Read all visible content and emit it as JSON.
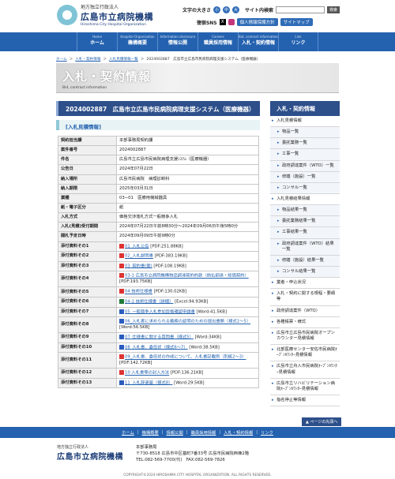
{
  "header": {
    "org_small": "地方独立行政法人",
    "org_name": "広島市立病院機構",
    "org_en": "Hiroshima City Hospital Organization",
    "font_size_label": "文字の大きさ",
    "font_btns": [
      "小",
      "中",
      "大"
    ],
    "search_label": "サイト内検索",
    "search_button": "検索",
    "sns_label": "徳宿SNS",
    "privacy_button": "個人情報保護方針",
    "sitemap_button": "サイトマップ"
  },
  "nav": [
    {
      "en": "Home",
      "jp": "ホーム"
    },
    {
      "en": "Hospital Organization",
      "jp": "機構概要"
    },
    {
      "en": "Information disclosure",
      "jp": "情報公開"
    },
    {
      "en": "Careers",
      "jp": "職員採用情報"
    },
    {
      "en": "Bid, contract information",
      "jp": "入札・契約情報"
    },
    {
      "en": "Link",
      "jp": "リンク"
    }
  ],
  "breadcrumb": [
    "ホーム",
    "入札・契約情報",
    "入札見積情報一覧",
    "2024002887　広島市立広島市民病院病理支援システム（医療機器）"
  ],
  "banner": {
    "title": "入札・契約情報",
    "subtitle": "Bid, contract information"
  },
  "page_title": "2024002887　広島市立広島市民病院病理支援システム（医療機器）",
  "section_title": "[入札見積情報]",
  "details": [
    {
      "k": "契約担当課",
      "v": "本部事務局契約課"
    },
    {
      "k": "案件番号",
      "v": "2024002887"
    },
    {
      "k": "件名",
      "v": "広島市立広島市民病院病理支援ｼｽﾃﾑ（医療機器）"
    },
    {
      "k": "公告日",
      "v": "2024年07月22日"
    },
    {
      "k": "納入場所",
      "v": "広島市民病院　病理診断科"
    },
    {
      "k": "納入期限",
      "v": "2025年03月31日"
    },
    {
      "k": "業種",
      "v": "03−01　医療用機械器具"
    },
    {
      "k": "紙・電子区分",
      "v": "紙"
    },
    {
      "k": "入札方式",
      "v": "価格交渉落札方式一般競争入札"
    },
    {
      "k": "入札(見積)受付期間",
      "v": "2024年07月22日午前8時30分〜2024年09月06日午後5時0分"
    },
    {
      "k": "開札予定日時",
      "v": "2024年09月09日午前9時0分"
    }
  ],
  "attachments": [
    {
      "k": "添付資料その1",
      "icon": "pdf",
      "link": "01_入札公告",
      "meta": "[PDF:251.88KB]"
    },
    {
      "k": "添付資料その2",
      "icon": "pdf",
      "link": "02_入札説明書",
      "meta": "[PDF:383.19KB]"
    },
    {
      "k": "添付資料その3",
      "icon": "pdf",
      "link": "03_契約書(案)",
      "meta": "[PDF:108.19KB]"
    },
    {
      "k": "添付資料その4",
      "icon": "pdf",
      "link": "03-1 広島市立病院機構物品調達契約約款（前払調達・総価契約）",
      "meta": "[PDF:193.75KB]"
    },
    {
      "k": "添付資料その5",
      "icon": "pdf",
      "link": "04 技術仕様書",
      "meta": "[PDF:130.02KB]"
    },
    {
      "k": "添付資料その6",
      "icon": "xls",
      "link": "04-1 技術仕様書（詳細）",
      "meta": "[Excel:94.93KB]"
    },
    {
      "k": "添付資料その7",
      "icon": "doc",
      "link": "05_一般競争入札参加資格確認申請書",
      "meta": "[Word:41.5KB]"
    },
    {
      "k": "添付資料その8",
      "icon": "doc",
      "link": "06_入札者に求められる義務の証明のための提出書類（様式1〜5）",
      "meta": "[Word:56.5KB]"
    },
    {
      "k": "添付資料その9",
      "icon": "doc",
      "link": "07_仕様書に関する質問書（様式5）",
      "meta": "[Word:34KB]"
    },
    {
      "k": "添付資料その10",
      "icon": "doc",
      "link": "08_入札書、委任状（様式6〜7）",
      "meta": "[Word:38.5KB]"
    },
    {
      "k": "添付資料その11",
      "icon": "pdf",
      "link": "09_入札書、委任状の作成について、入札書記載例（別紙2〜3）",
      "meta": "[PDF:142.72KB]"
    },
    {
      "k": "添付資料その12",
      "icon": "pdf",
      "link": "10 入札書等の封入方法",
      "meta": "[PDF:136.21KB]"
    },
    {
      "k": "添付資料その13",
      "icon": "doc",
      "link": "11_入札辞退届（様式8）",
      "meta": "[Word:29.5KB]"
    }
  ],
  "sidebar": {
    "title": "入札・契約情報",
    "items": [
      {
        "label": "入札見積情報",
        "cls": "grp"
      },
      {
        "label": "物品一覧",
        "cls": "sub"
      },
      {
        "label": "委託業務一覧",
        "cls": "sub"
      },
      {
        "label": "工事一覧",
        "cls": "sub"
      },
      {
        "label": "政府調達案件（WTO）一覧",
        "cls": "sub"
      },
      {
        "label": "修繕（施設）一覧",
        "cls": "sub"
      },
      {
        "label": "コンサル一覧",
        "cls": "sub"
      },
      {
        "label": "入札見積結果情報",
        "cls": "grp"
      },
      {
        "label": "物品結果一覧",
        "cls": "sub"
      },
      {
        "label": "委託業務結果一覧",
        "cls": "sub"
      },
      {
        "label": "工事結果一覧",
        "cls": "sub"
      },
      {
        "label": "政府調達案件（WTO）結果一覧",
        "cls": "sub"
      },
      {
        "label": "修繕（施設）結果一覧",
        "cls": "sub"
      },
      {
        "label": "コンサル結果一覧",
        "cls": "sub"
      },
      {
        "label": "業者・申込状況",
        "cls": "grp"
      },
      {
        "label": "入札・契約に関する規程・要綱等",
        "cls": "grp"
      },
      {
        "label": "政府調達案件（WTO）",
        "cls": "grp"
      },
      {
        "label": "各種帳票・様式",
        "cls": "grp"
      },
      {
        "label": "広島市立広島市民病院オープンカウンター見積情報",
        "cls": "grp"
      },
      {
        "label": "北部医療センター安佐市民病院ｵｰﾌﾟﾝｶｳﾝﾀｰ見積情報",
        "cls": "grp"
      },
      {
        "label": "広島市立舟入市民病院ｵｰﾌﾟﾝｶｳﾝﾀｰ見積情報",
        "cls": "grp"
      },
      {
        "label": "広島市立リハビリテーション病院ｵｰﾌﾟﾝｶｳﾝﾀｰ見積情報",
        "cls": "grp"
      },
      {
        "label": "指名停止等情報",
        "cls": "grp"
      }
    ]
  },
  "pagetop": "▲ ページの先頭へ",
  "footer_nav": [
    "ホーム",
    "機構概要",
    "情報公開",
    "職員採用情報",
    "入札・契約情報",
    "リンク"
  ],
  "footer": {
    "org_small": "地方独立行政法人",
    "org_name": "広島市立病院機構",
    "office": "本部事務局",
    "address": "〒730-8518 広島市中区基町7番33号 広島市民病院西棟2階",
    "tel": "TEL:082-569-7700(代)　FAX:082-569-7826",
    "copyright": "COPYRIGHT©2024 HIROSHIMA CITY HOSPITAL ORGANIZATION. ALL RIGHTS RESERVED."
  },
  "colors": {
    "primary": "#2462b0",
    "title_bar": "#2d4f8a"
  }
}
